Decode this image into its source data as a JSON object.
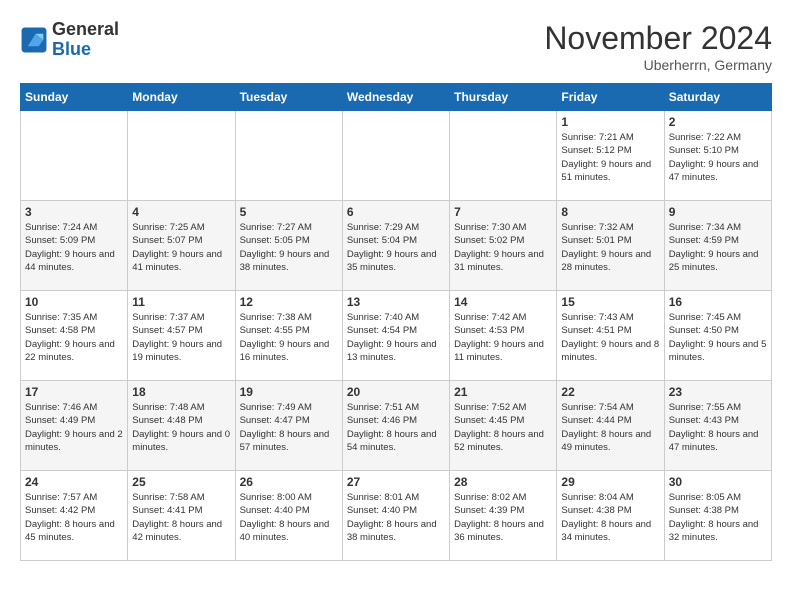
{
  "logo": {
    "line1": "General",
    "line2": "Blue"
  },
  "title": "November 2024",
  "subtitle": "Uberherrn, Germany",
  "weekdays": [
    "Sunday",
    "Monday",
    "Tuesday",
    "Wednesday",
    "Thursday",
    "Friday",
    "Saturday"
  ],
  "weeks": [
    [
      {
        "day": "",
        "info": ""
      },
      {
        "day": "",
        "info": ""
      },
      {
        "day": "",
        "info": ""
      },
      {
        "day": "",
        "info": ""
      },
      {
        "day": "",
        "info": ""
      },
      {
        "day": "1",
        "info": "Sunrise: 7:21 AM\nSunset: 5:12 PM\nDaylight: 9 hours and 51 minutes."
      },
      {
        "day": "2",
        "info": "Sunrise: 7:22 AM\nSunset: 5:10 PM\nDaylight: 9 hours and 47 minutes."
      }
    ],
    [
      {
        "day": "3",
        "info": "Sunrise: 7:24 AM\nSunset: 5:09 PM\nDaylight: 9 hours and 44 minutes."
      },
      {
        "day": "4",
        "info": "Sunrise: 7:25 AM\nSunset: 5:07 PM\nDaylight: 9 hours and 41 minutes."
      },
      {
        "day": "5",
        "info": "Sunrise: 7:27 AM\nSunset: 5:05 PM\nDaylight: 9 hours and 38 minutes."
      },
      {
        "day": "6",
        "info": "Sunrise: 7:29 AM\nSunset: 5:04 PM\nDaylight: 9 hours and 35 minutes."
      },
      {
        "day": "7",
        "info": "Sunrise: 7:30 AM\nSunset: 5:02 PM\nDaylight: 9 hours and 31 minutes."
      },
      {
        "day": "8",
        "info": "Sunrise: 7:32 AM\nSunset: 5:01 PM\nDaylight: 9 hours and 28 minutes."
      },
      {
        "day": "9",
        "info": "Sunrise: 7:34 AM\nSunset: 4:59 PM\nDaylight: 9 hours and 25 minutes."
      }
    ],
    [
      {
        "day": "10",
        "info": "Sunrise: 7:35 AM\nSunset: 4:58 PM\nDaylight: 9 hours and 22 minutes."
      },
      {
        "day": "11",
        "info": "Sunrise: 7:37 AM\nSunset: 4:57 PM\nDaylight: 9 hours and 19 minutes."
      },
      {
        "day": "12",
        "info": "Sunrise: 7:38 AM\nSunset: 4:55 PM\nDaylight: 9 hours and 16 minutes."
      },
      {
        "day": "13",
        "info": "Sunrise: 7:40 AM\nSunset: 4:54 PM\nDaylight: 9 hours and 13 minutes."
      },
      {
        "day": "14",
        "info": "Sunrise: 7:42 AM\nSunset: 4:53 PM\nDaylight: 9 hours and 11 minutes."
      },
      {
        "day": "15",
        "info": "Sunrise: 7:43 AM\nSunset: 4:51 PM\nDaylight: 9 hours and 8 minutes."
      },
      {
        "day": "16",
        "info": "Sunrise: 7:45 AM\nSunset: 4:50 PM\nDaylight: 9 hours and 5 minutes."
      }
    ],
    [
      {
        "day": "17",
        "info": "Sunrise: 7:46 AM\nSunset: 4:49 PM\nDaylight: 9 hours and 2 minutes."
      },
      {
        "day": "18",
        "info": "Sunrise: 7:48 AM\nSunset: 4:48 PM\nDaylight: 9 hours and 0 minutes."
      },
      {
        "day": "19",
        "info": "Sunrise: 7:49 AM\nSunset: 4:47 PM\nDaylight: 8 hours and 57 minutes."
      },
      {
        "day": "20",
        "info": "Sunrise: 7:51 AM\nSunset: 4:46 PM\nDaylight: 8 hours and 54 minutes."
      },
      {
        "day": "21",
        "info": "Sunrise: 7:52 AM\nSunset: 4:45 PM\nDaylight: 8 hours and 52 minutes."
      },
      {
        "day": "22",
        "info": "Sunrise: 7:54 AM\nSunset: 4:44 PM\nDaylight: 8 hours and 49 minutes."
      },
      {
        "day": "23",
        "info": "Sunrise: 7:55 AM\nSunset: 4:43 PM\nDaylight: 8 hours and 47 minutes."
      }
    ],
    [
      {
        "day": "24",
        "info": "Sunrise: 7:57 AM\nSunset: 4:42 PM\nDaylight: 8 hours and 45 minutes."
      },
      {
        "day": "25",
        "info": "Sunrise: 7:58 AM\nSunset: 4:41 PM\nDaylight: 8 hours and 42 minutes."
      },
      {
        "day": "26",
        "info": "Sunrise: 8:00 AM\nSunset: 4:40 PM\nDaylight: 8 hours and 40 minutes."
      },
      {
        "day": "27",
        "info": "Sunrise: 8:01 AM\nSunset: 4:40 PM\nDaylight: 8 hours and 38 minutes."
      },
      {
        "day": "28",
        "info": "Sunrise: 8:02 AM\nSunset: 4:39 PM\nDaylight: 8 hours and 36 minutes."
      },
      {
        "day": "29",
        "info": "Sunrise: 8:04 AM\nSunset: 4:38 PM\nDaylight: 8 hours and 34 minutes."
      },
      {
        "day": "30",
        "info": "Sunrise: 8:05 AM\nSunset: 4:38 PM\nDaylight: 8 hours and 32 minutes."
      }
    ]
  ]
}
